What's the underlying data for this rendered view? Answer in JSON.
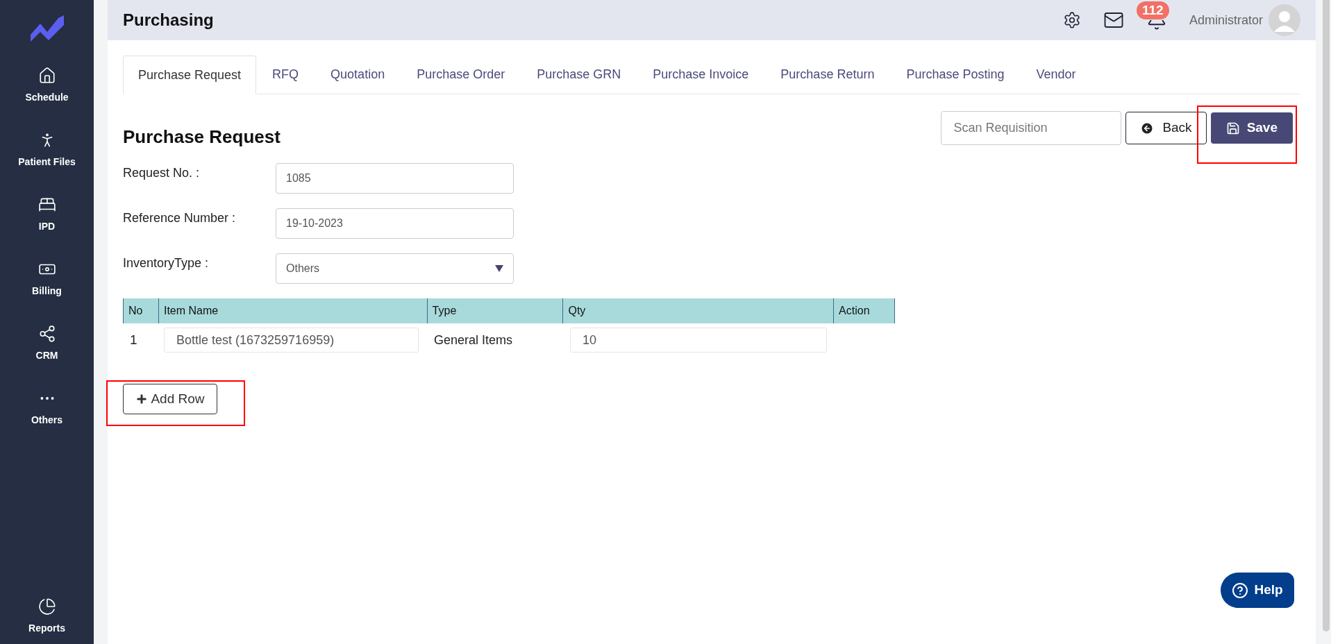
{
  "sidebar": {
    "items": [
      {
        "label": "Schedule"
      },
      {
        "label": "Patient Files"
      },
      {
        "label": "IPD"
      },
      {
        "label": "Billing"
      },
      {
        "label": "CRM"
      },
      {
        "label": "Others"
      }
    ],
    "bottom_item": {
      "label": "Reports"
    }
  },
  "header": {
    "title": "Purchasing",
    "notification_count": "112",
    "user_name": "Administrator"
  },
  "tabs": [
    {
      "label": "Purchase Request",
      "selected": true
    },
    {
      "label": "RFQ",
      "selected": false
    },
    {
      "label": "Quotation",
      "selected": false
    },
    {
      "label": "Purchase Order",
      "selected": false
    },
    {
      "label": "Purchase GRN",
      "selected": false
    },
    {
      "label": "Purchase Invoice",
      "selected": false
    },
    {
      "label": "Purchase Return",
      "selected": false
    },
    {
      "label": "Purchase Posting",
      "selected": false
    },
    {
      "label": "Vendor",
      "selected": false
    }
  ],
  "form": {
    "title": "Purchase Request",
    "scan_field": {
      "placeholder": "Scan Requisition"
    },
    "back_button": "Back",
    "save_button": "Save",
    "fields": [
      {
        "label": "Request No. :",
        "value": "1085",
        "kind": "text"
      },
      {
        "label": "Reference Number :",
        "value": "19-10-2023",
        "kind": "text"
      },
      {
        "label": "InventoryType :",
        "value": "Others",
        "kind": "select"
      }
    ]
  },
  "table": {
    "columns": [
      "No",
      "Item Name",
      "Type",
      "Qty",
      "Action"
    ],
    "rows": [
      {
        "no": "1",
        "item_name": "Bottle test (1673259716959)",
        "type": "General Items",
        "qty": "10"
      }
    ]
  },
  "add_row_button": "Add Row",
  "help_button": "Help"
}
